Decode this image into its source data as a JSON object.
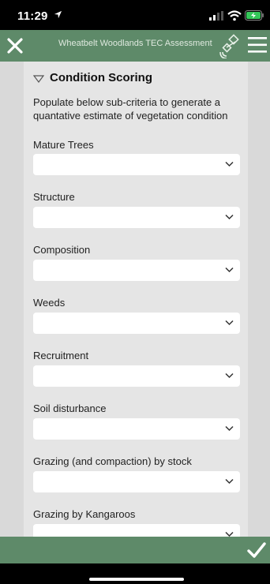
{
  "status": {
    "time": "11:29"
  },
  "topbar": {
    "title": "Wheatbelt Woodlands TEC Assessment"
  },
  "section": {
    "title": "Condition Scoring",
    "description": "Populate below sub-criteria to generate a quantative estimate of vegetation condition"
  },
  "fields": [
    {
      "label": "Mature Trees",
      "value": ""
    },
    {
      "label": "Structure",
      "value": ""
    },
    {
      "label": "Composition",
      "value": ""
    },
    {
      "label": "Weeds",
      "value": ""
    },
    {
      "label": "Recruitment",
      "value": ""
    },
    {
      "label": "Soil disturbance",
      "value": ""
    },
    {
      "label": "Grazing (and compaction) by stock",
      "value": ""
    },
    {
      "label": "Grazing by Kangaroos",
      "value": ""
    }
  ],
  "colors": {
    "accent": "#5e8a69",
    "panel": "#e5e5e5",
    "background": "#d9d9d9"
  }
}
